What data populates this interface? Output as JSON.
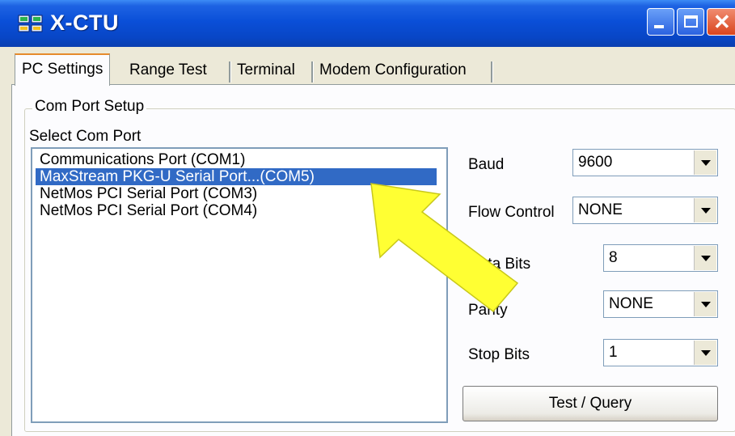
{
  "window": {
    "title": "X-CTU"
  },
  "tabs": [
    {
      "label": "PC Settings",
      "active": true
    },
    {
      "label": "Range Test",
      "active": false
    },
    {
      "label": "Terminal",
      "active": false
    },
    {
      "label": "Modem Configuration",
      "active": false
    }
  ],
  "com_port_setup": {
    "group_label": "Com Port Setup",
    "select_label": "Select Com Port",
    "ports": [
      {
        "label": "Communications Port (COM1)",
        "selected": false
      },
      {
        "label": "MaxStream PKG-U Serial Port...(COM5)",
        "selected": true
      },
      {
        "label": "NetMos PCI Serial Port (COM3)",
        "selected": false
      },
      {
        "label": "NetMos PCI Serial Port (COM4)",
        "selected": false
      }
    ]
  },
  "settings": {
    "baud": {
      "label": "Baud",
      "value": "9600"
    },
    "flow_control": {
      "label": "Flow Control",
      "value": "NONE"
    },
    "data_bits": {
      "label": "Data Bits",
      "value": "8"
    },
    "parity": {
      "label": "Parity",
      "value": "NONE"
    },
    "stop_bits": {
      "label": "Stop Bits",
      "value": "1"
    }
  },
  "test_button_label": "Test / Query",
  "colors": {
    "titlebar": "#0a4fd8",
    "selection": "#316ac5",
    "annotation_arrow": "#ffff33"
  },
  "icons": {
    "app": "xctu-app-icon",
    "minimize": "minimize-icon",
    "maximize": "maximize-icon",
    "close": "close-icon",
    "dropdown": "chevron-down-icon"
  }
}
